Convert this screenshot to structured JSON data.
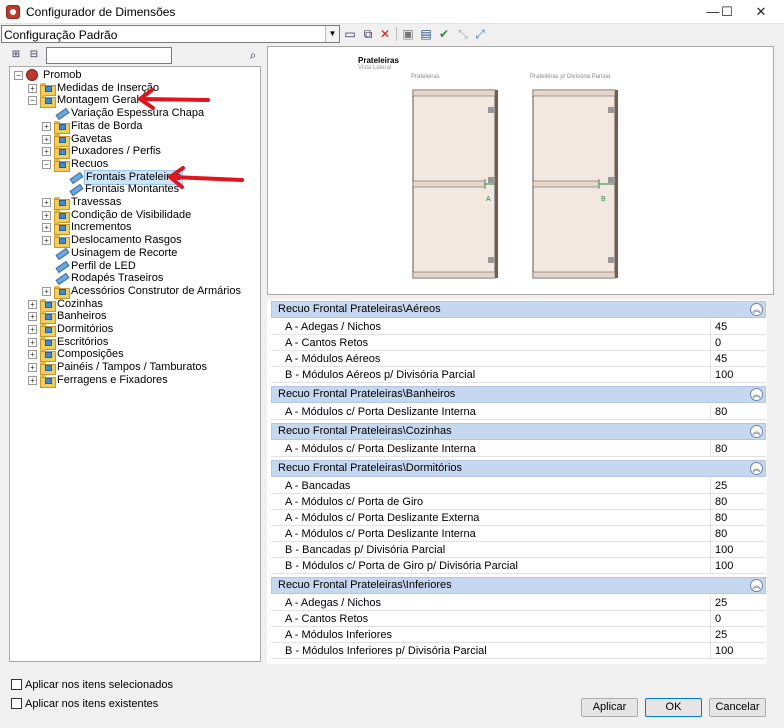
{
  "window": {
    "title": "Configurador de Dimensões",
    "minimize": "—",
    "maximize": "☐",
    "close": "✕"
  },
  "toolbar": {
    "config_value": "Configuração Padrão",
    "search_placeholder": ""
  },
  "tree": [
    {
      "label": "Promob",
      "level": 0,
      "icon": "promob",
      "expanded": true
    },
    {
      "label": "Medidas de Inserção",
      "level": 1,
      "icon": "folder",
      "expanded": false
    },
    {
      "label": "Montagem Geral",
      "level": 1,
      "icon": "folder",
      "expanded": true
    },
    {
      "label": "Variação Espessura Chapa",
      "level": 2,
      "icon": "item"
    },
    {
      "label": "Fitas de Borda",
      "level": 2,
      "icon": "folder",
      "expanded": false
    },
    {
      "label": "Gavetas",
      "level": 2,
      "icon": "folder",
      "expanded": false
    },
    {
      "label": "Puxadores / Perfis",
      "level": 2,
      "icon": "folder",
      "expanded": false
    },
    {
      "label": "Recuos",
      "level": 2,
      "icon": "folder",
      "expanded": true
    },
    {
      "label": "Frontais Prateleiras",
      "level": 3,
      "icon": "item",
      "selected": true
    },
    {
      "label": "Frontais Montantes",
      "level": 3,
      "icon": "item"
    },
    {
      "label": "Travessas",
      "level": 2,
      "icon": "folder",
      "expanded": false
    },
    {
      "label": "Condição de Visibilidade",
      "level": 2,
      "icon": "folder",
      "expanded": false
    },
    {
      "label": "Incrementos",
      "level": 2,
      "icon": "folder",
      "expanded": false
    },
    {
      "label": "Deslocamento Rasgos",
      "level": 2,
      "icon": "folder",
      "expanded": false
    },
    {
      "label": "Usinagem de Recorte",
      "level": 2,
      "icon": "item"
    },
    {
      "label": "Perfil de LED",
      "level": 2,
      "icon": "item"
    },
    {
      "label": "Rodapés Traseiros",
      "level": 2,
      "icon": "item"
    },
    {
      "label": "Acessórios Construtor de Armários",
      "level": 2,
      "icon": "folder",
      "expanded": false
    },
    {
      "label": "Cozinhas",
      "level": 1,
      "icon": "folder",
      "expanded": false
    },
    {
      "label": "Banheiros",
      "level": 1,
      "icon": "folder",
      "expanded": false
    },
    {
      "label": "Dormitórios",
      "level": 1,
      "icon": "folder",
      "expanded": false
    },
    {
      "label": "Escritórios",
      "level": 1,
      "icon": "folder",
      "expanded": false
    },
    {
      "label": "Composições",
      "level": 1,
      "icon": "folder",
      "expanded": false
    },
    {
      "label": "Painéis / Tampos / Tamburatos",
      "level": 1,
      "icon": "folder",
      "expanded": false
    },
    {
      "label": "Ferragens e Fixadores",
      "level": 1,
      "icon": "folder",
      "expanded": false
    }
  ],
  "preview": {
    "title": "Prateleiras",
    "subtitle": "Vista Lateral",
    "left_caption": "Prateleiras",
    "right_caption": "Prateleiras p/ Divisória Parcial",
    "left_marker": "A",
    "right_marker": "B"
  },
  "groups": [
    {
      "title": "Recuo Frontal Prateleiras\\Aéreos",
      "rows": [
        {
          "name": "A - Adegas / Nichos",
          "value": "45"
        },
        {
          "name": "A - Cantos Retos",
          "value": "0"
        },
        {
          "name": "A - Módulos Aéreos",
          "value": "45"
        },
        {
          "name": "B - Módulos Aéreos p/ Divisória Parcial",
          "value": "100"
        }
      ]
    },
    {
      "title": "Recuo Frontal Prateleiras\\Banheiros",
      "rows": [
        {
          "name": "A - Módulos c/ Porta Deslizante Interna",
          "value": "80"
        }
      ]
    },
    {
      "title": "Recuo Frontal Prateleiras\\Cozinhas",
      "rows": [
        {
          "name": "A - Módulos c/ Porta Deslizante Interna",
          "value": "80"
        }
      ]
    },
    {
      "title": "Recuo Frontal Prateleiras\\Dormitórios",
      "rows": [
        {
          "name": "A - Bancadas",
          "value": "25"
        },
        {
          "name": "A - Módulos c/ Porta de Giro",
          "value": "80"
        },
        {
          "name": "A - Módulos c/ Porta Deslizante Externa",
          "value": "80"
        },
        {
          "name": "A - Módulos c/ Porta Deslizante Interna",
          "value": "80"
        },
        {
          "name": "B - Bancadas p/ Divisória Parcial",
          "value": "100"
        },
        {
          "name": "B - Módulos c/ Porta de Giro p/ Divisória Parcial",
          "value": "100"
        }
      ]
    },
    {
      "title": "Recuo Frontal Prateleiras\\Inferiores",
      "rows": [
        {
          "name": "A - Adegas / Nichos",
          "value": "25"
        },
        {
          "name": "A - Cantos Retos",
          "value": "0"
        },
        {
          "name": "A - Módulos Inferiores",
          "value": "25"
        },
        {
          "name": "B - Módulos Inferiores p/ Divisória Parcial",
          "value": "100"
        }
      ]
    }
  ],
  "options": {
    "apply_selected": "Aplicar nos itens selecionados",
    "apply_existing": "Aplicar nos itens existentes"
  },
  "buttons": {
    "apply": "Aplicar",
    "ok": "OK",
    "cancel": "Cancelar"
  },
  "colors": {
    "group_header": "#c6d7f0",
    "annotation_arrow": "#e0141e",
    "selection": "#cde3f7"
  }
}
